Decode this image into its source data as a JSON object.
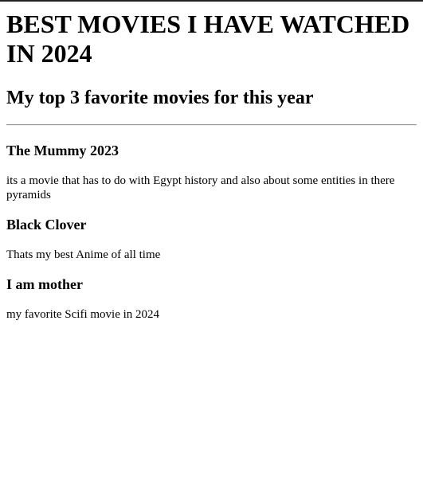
{
  "page": {
    "title": "BEST MOVIES I HAVE WATCHED IN 2024",
    "subtitle": "My top 3 favorite movies for this year"
  },
  "movies": [
    {
      "title": "The Mummy 2023",
      "description": "its a movie that has to do with Egypt history and also about some entities in there pyramids"
    },
    {
      "title": "Black Clover",
      "description": "Thats my best Anime of all time"
    },
    {
      "title": "I am mother",
      "description": "my favorite Scifi movie in 2024"
    }
  ]
}
